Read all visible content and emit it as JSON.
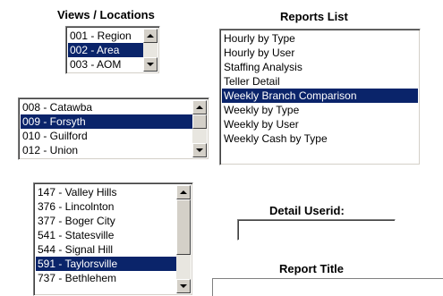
{
  "views": {
    "title": "Views / Locations",
    "level_list": {
      "items": [
        "001 - Region",
        "002 - Area",
        "003 - AOM"
      ],
      "selected": 1
    },
    "area_list": {
      "items": [
        "008 - Catawba",
        "009 - Forsyth",
        "010 - Guilford",
        "012 - Union"
      ],
      "selected": 1
    },
    "branch_list": {
      "items": [
        "147 - Valley Hills",
        "376 - Lincolnton",
        "377 - Boger City",
        "541 - Statesville",
        "544 - Signal Hill",
        "591 - Taylorsville",
        "737 - Bethlehem"
      ],
      "selected": 5
    }
  },
  "reports": {
    "title": "Reports List",
    "items": [
      "Hourly by Type",
      "Hourly by User",
      "Staffing Analysis",
      "Teller Detail",
      "Weekly Branch Comparison",
      "Weekly by Type",
      "Weekly by User",
      "Weekly Cash by Type"
    ],
    "selected": 4
  },
  "detail_userid": {
    "label": "Detail Userid:",
    "value": ""
  },
  "report_title": {
    "label": "Report Title",
    "value": ""
  },
  "colors": {
    "selection": "#0a246a",
    "selection_text": "#ffffff"
  },
  "icons": {
    "scroll_up": "triangle-up-icon",
    "scroll_down": "triangle-down-icon"
  }
}
